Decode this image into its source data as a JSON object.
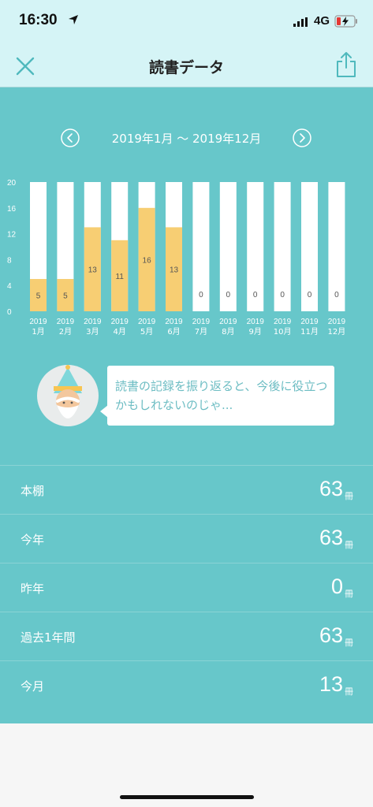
{
  "status_bar": {
    "time": "16:30",
    "network": "4G"
  },
  "header": {
    "title": "読書データ"
  },
  "date_range": {
    "label": "2019年1月 〜 2019年12月"
  },
  "chart_data": {
    "type": "bar",
    "categories": [
      [
        "2019",
        "1月"
      ],
      [
        "2019",
        "2月"
      ],
      [
        "2019",
        "3月"
      ],
      [
        "2019",
        "4月"
      ],
      [
        "2019",
        "5月"
      ],
      [
        "2019",
        "6月"
      ],
      [
        "2019",
        "7月"
      ],
      [
        "2019",
        "8月"
      ],
      [
        "2019",
        "9月"
      ],
      [
        "2019",
        "10月"
      ],
      [
        "2019",
        "11月"
      ],
      [
        "2019",
        "12月"
      ]
    ],
    "values": [
      5,
      5,
      13,
      11,
      16,
      13,
      0,
      0,
      0,
      0,
      0,
      0
    ],
    "data_labels": [
      "5",
      "5",
      "13",
      "11",
      "16",
      "13",
      "0",
      "0",
      "0",
      "0",
      "0",
      "0"
    ],
    "ylim": [
      0,
      20
    ],
    "yticks": [
      "0",
      "4",
      "8",
      "12",
      "16",
      "20"
    ],
    "bar_color": "#f7ce73",
    "track_color": "#ffffff"
  },
  "speech": {
    "text": "読書の記録を振り返ると、今後に役立つかもしれないのじゃ..."
  },
  "stats": [
    {
      "label": "本棚",
      "value": "63",
      "unit": "冊"
    },
    {
      "label": "今年",
      "value": "63",
      "unit": "冊"
    },
    {
      "label": "昨年",
      "value": "0",
      "unit": "冊"
    },
    {
      "label": "過去1年間",
      "value": "63",
      "unit": "冊"
    },
    {
      "label": "今月",
      "value": "13",
      "unit": "冊"
    }
  ],
  "colors": {
    "accent": "#67c7ca",
    "header_bg": "#d5f4f6",
    "bar": "#f7ce73",
    "speech_text": "#6dbdc3"
  },
  "icons": {
    "close": "close-icon",
    "share": "share-icon",
    "prev": "chevron-left-icon",
    "next": "chevron-right-icon"
  }
}
